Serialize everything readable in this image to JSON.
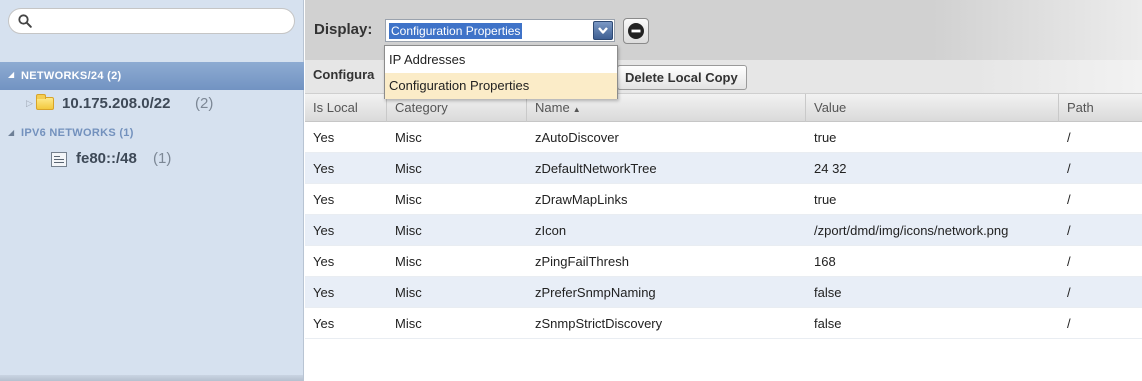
{
  "search": {
    "placeholder": "",
    "value": ""
  },
  "tree": {
    "networks_header": {
      "label": "NETWORKS/24",
      "count": "(2)"
    },
    "networks": [
      {
        "name": "10.175.208.0/22",
        "count": "(2)"
      }
    ],
    "ipv6_header": {
      "label": "IPV6 NETWORKS",
      "count": "(1)"
    },
    "ipv6_networks": [
      {
        "name": "fe80::/48",
        "count": "(1)"
      }
    ]
  },
  "toolbar": {
    "display_label": "Display:",
    "display_selected": "Configuration Properties",
    "config_label": "Configura",
    "delete_button_label": "Delete Local Copy"
  },
  "dropdown": {
    "options": [
      "IP Addresses",
      "Configuration Properties"
    ],
    "highlighted": "Configuration Properties"
  },
  "grid": {
    "columns": [
      "Is Local",
      "Category",
      "Name",
      "Value",
      "Path"
    ],
    "sort_column": "Name",
    "sort_direction": "ascending",
    "rows": [
      {
        "is_local": "Yes",
        "category": "Misc",
        "name": "zAutoDiscover",
        "value": "true",
        "path": "/"
      },
      {
        "is_local": "Yes",
        "category": "Misc",
        "name": "zDefaultNetworkTree",
        "value": "24 32",
        "path": "/"
      },
      {
        "is_local": "Yes",
        "category": "Misc",
        "name": "zDrawMapLinks",
        "value": "true",
        "path": "/"
      },
      {
        "is_local": "Yes",
        "category": "Misc",
        "name": "zIcon",
        "value": "/zport/dmd/img/icons/network.png",
        "path": "/"
      },
      {
        "is_local": "Yes",
        "category": "Misc",
        "name": "zPingFailThresh",
        "value": "168",
        "path": "/"
      },
      {
        "is_local": "Yes",
        "category": "Misc",
        "name": "zPreferSnmpNaming",
        "value": "false",
        "path": "/"
      },
      {
        "is_local": "Yes",
        "category": "Misc",
        "name": "zSnmpStrictDiscovery",
        "value": "false",
        "path": "/"
      }
    ]
  },
  "colors": {
    "tree_bg": "#d6e1ef",
    "tree_selected": "#7e9fcb",
    "select_highlight": "#3f73c8",
    "menu_hover": "#fbecc8",
    "row_alt": "#e8eef7"
  }
}
